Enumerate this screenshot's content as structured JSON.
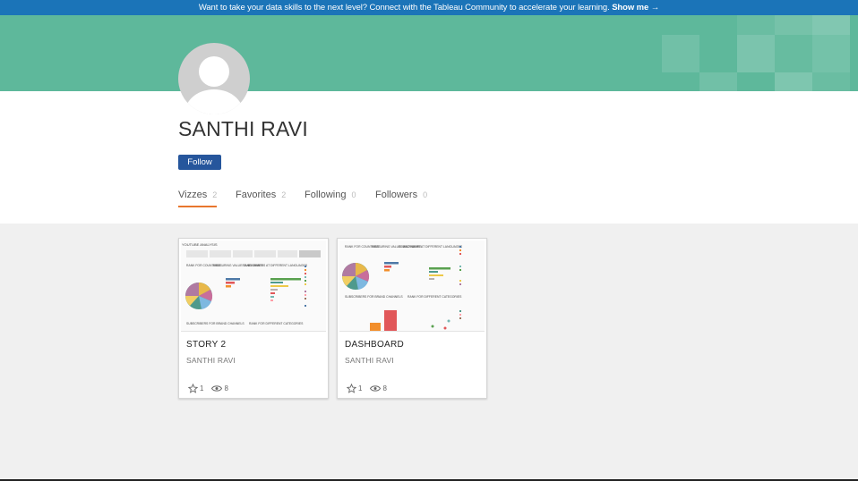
{
  "banner": {
    "text": "Want to take your data skills to the next level? Connect with the Tableau Community to accelerate your learning.",
    "link": "Show me →"
  },
  "colors": {
    "banner_bg": "#1b74b8",
    "hero_bg": "#5eb89b",
    "follow_button": "#26569c",
    "active_tab_underline": "#e8762d"
  },
  "profile": {
    "name": "SANTHI RAVI",
    "avatar_icon": "user-avatar-icon",
    "follow_label": "Follow"
  },
  "tabs": [
    {
      "label": "Vizzes",
      "count": "2",
      "active": true
    },
    {
      "label": "Favorites",
      "count": "2",
      "active": false
    },
    {
      "label": "Following",
      "count": "0",
      "active": false
    },
    {
      "label": "Followers",
      "count": "0",
      "active": false
    }
  ],
  "cards": [
    {
      "title": "STORY 2",
      "author": "SANTHI RAVI",
      "favorites": "1",
      "views": "8",
      "thumbnail": {
        "header": "YOUTUBE ANALYSIS",
        "blocks": [
          "RANK FOR COUNTRIES",
          "MEASURING VALUES AND NAMES",
          "SUBSCRIBERS AT DIFFERENT LANGUAGES"
        ],
        "bottom_blocks": [
          "SUBSCRIBERS FOR BRAND CHANNELS",
          "RANK FOR DIFFERENT CATEGORIES"
        ]
      }
    },
    {
      "title": "DASHBOARD",
      "author": "SANTHI RAVI",
      "favorites": "1",
      "views": "8",
      "thumbnail": {
        "blocks": [
          "RANK FOR COUNTRIES",
          "MEASURING VALUES AND NAMES",
          "SUBSCRIBERS AT DIFFERENT LANGUAGES"
        ],
        "bottom_blocks": [
          "SUBSCRIBERS FOR BRAND CHANNELS",
          "RANK FOR DIFFERENT CATEGORIES"
        ]
      }
    }
  ]
}
